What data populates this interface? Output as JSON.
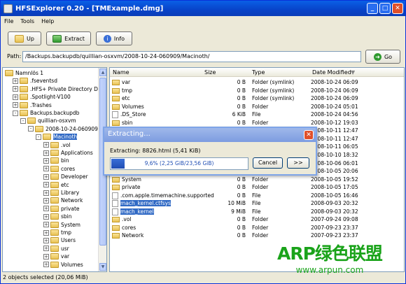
{
  "window": {
    "title": "HFSExplorer 0.20 - [TMExample.dmg]"
  },
  "menu": [
    "File",
    "Tools",
    "Help"
  ],
  "toolbar": {
    "up": "Up",
    "extract": "Extract",
    "info": "Info",
    "go": "Go"
  },
  "path": {
    "label": "Path:",
    "value": "/Backups.backupdb/quillian-osxvm/2008-10-24-060909/Macinoth/"
  },
  "tree": [
    {
      "label": "Namnlös 1",
      "exp": "",
      "indent": 0
    },
    {
      "label": ".fseventsd",
      "exp": "+",
      "indent": 1
    },
    {
      "label": ".HFS+ Private Directory Data",
      "exp": "+",
      "indent": 1
    },
    {
      "label": ".Spotlight-V100",
      "exp": "+",
      "indent": 1
    },
    {
      "label": ".Trashes",
      "exp": "+",
      "indent": 1
    },
    {
      "label": "Backups.backupdb",
      "exp": "-",
      "indent": 1
    },
    {
      "label": "quillian-osxvm",
      "exp": "-",
      "indent": 2
    },
    {
      "label": "2008-10-24-060909",
      "exp": "-",
      "indent": 3
    },
    {
      "label": "Macinoth",
      "exp": "-",
      "indent": 4,
      "selected": true
    },
    {
      "label": ".vol",
      "exp": "+",
      "indent": 5
    },
    {
      "label": "Applications",
      "exp": "+",
      "indent": 5
    },
    {
      "label": "bin",
      "exp": "+",
      "indent": 5
    },
    {
      "label": "cores",
      "exp": "+",
      "indent": 5
    },
    {
      "label": "Developer",
      "exp": "+",
      "indent": 5
    },
    {
      "label": "etc",
      "exp": "+",
      "indent": 5
    },
    {
      "label": "Library",
      "exp": "+",
      "indent": 5
    },
    {
      "label": "Network",
      "exp": "+",
      "indent": 5
    },
    {
      "label": "private",
      "exp": "+",
      "indent": 5
    },
    {
      "label": "sbin",
      "exp": "+",
      "indent": 5
    },
    {
      "label": "System",
      "exp": "+",
      "indent": 5
    },
    {
      "label": "tmp",
      "exp": "+",
      "indent": 5
    },
    {
      "label": "Users",
      "exp": "+",
      "indent": 5
    },
    {
      "label": "usr",
      "exp": "+",
      "indent": 5
    },
    {
      "label": "var",
      "exp": "+",
      "indent": 5
    },
    {
      "label": "Volumes",
      "exp": "+",
      "indent": 5
    }
  ],
  "list": {
    "headers": {
      "name": "Name",
      "size": "Size",
      "type": "Type",
      "date": "Date Modified"
    },
    "rows": [
      {
        "name": "var",
        "size": "0 B",
        "type": "Folder (symlink)",
        "date": "2008-10-24 06:09",
        "kind": "folder"
      },
      {
        "name": "tmp",
        "size": "0 B",
        "type": "Folder (symlink)",
        "date": "2008-10-24 06:09",
        "kind": "folder"
      },
      {
        "name": "etc",
        "size": "0 B",
        "type": "Folder (symlink)",
        "date": "2008-10-24 06:09",
        "kind": "folder"
      },
      {
        "name": "Volumes",
        "size": "0 B",
        "type": "Folder",
        "date": "2008-10-24 05:01",
        "kind": "folder"
      },
      {
        "name": ".DS_Store",
        "size": "6 KiB",
        "type": "File",
        "date": "2008-10-24 04:56",
        "kind": "file"
      },
      {
        "name": "sbin",
        "size": "0 B",
        "type": "Folder",
        "date": "2008-10-12 19:03",
        "kind": "folder"
      },
      {
        "name": "",
        "size": "",
        "type": "",
        "date": "2008-10-11 12:47",
        "kind": "blank"
      },
      {
        "name": "",
        "size": "",
        "type": "",
        "date": "2008-10-11 12:47",
        "kind": "blank"
      },
      {
        "name": "",
        "size": "",
        "type": "",
        "date": "2008-10-11 06:05",
        "kind": "blank"
      },
      {
        "name": "",
        "size": "",
        "type": "",
        "date": "2008-10-10 18:32",
        "kind": "blank"
      },
      {
        "name": "",
        "size": "",
        "type": "",
        "date": "2008-10-06 06:01",
        "kind": "blank"
      },
      {
        "name": "",
        "size": "",
        "type": "",
        "date": "2008-10-05 20:06",
        "kind": "blank"
      },
      {
        "name": "System",
        "size": "0 B",
        "type": "Folder",
        "date": "2008-10-05 19:52",
        "kind": "folder"
      },
      {
        "name": "private",
        "size": "0 B",
        "type": "Folder",
        "date": "2008-10-05 17:05",
        "kind": "folder"
      },
      {
        "name": ".com.apple.timemachine.supported",
        "size": "0 B",
        "type": "File",
        "date": "2008-10-05 16:46",
        "kind": "file"
      },
      {
        "name": "mach_kernel.ctfsys",
        "size": "10 MiB",
        "type": "File",
        "date": "2008-09-03 20:32",
        "kind": "file",
        "selected": true
      },
      {
        "name": "mach_kernel",
        "size": "9 MiB",
        "type": "File",
        "date": "2008-09-03 20:32",
        "kind": "file",
        "selected": true
      },
      {
        "name": ".vol",
        "size": "0 B",
        "type": "Folder",
        "date": "2007-09-24 09:08",
        "kind": "folder"
      },
      {
        "name": "cores",
        "size": "0 B",
        "type": "Folder",
        "date": "2007-09-23 23:37",
        "kind": "folder"
      },
      {
        "name": "Network",
        "size": "0 B",
        "type": "Folder",
        "date": "2007-09-23 23:37",
        "kind": "folder"
      }
    ]
  },
  "status": "2 objects selected (20,06 MiB)",
  "dialog": {
    "title": "Extracting...",
    "text": "Extracting: 8826.html (5,41 KiB)",
    "progress_text": "9,6% (2,25 GiB/23,56 GiB)",
    "progress": 0.096,
    "cancel": "Cancel",
    "more": ">>"
  },
  "watermark": {
    "line1": "ARP绿色联盟",
    "line2": "www.arpun.com"
  }
}
